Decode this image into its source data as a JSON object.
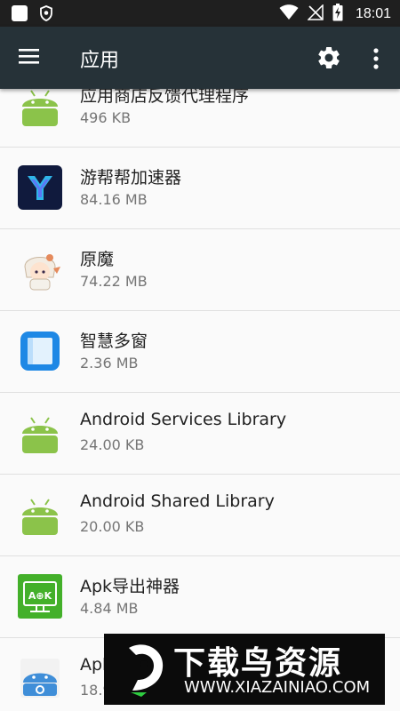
{
  "status_bar": {
    "time": "18:01",
    "icons": [
      "notification-square-icon",
      "shield-icon",
      "wifi-icon",
      "no-sim-icon",
      "battery-charging-icon"
    ]
  },
  "app_bar": {
    "title": "应用",
    "icons": [
      "menu-icon",
      "settings-gear-icon",
      "more-vert-icon"
    ]
  },
  "apps": [
    {
      "name": "应用商店反馈代理程序",
      "size": "496 KB",
      "icon": "android-robot-icon"
    },
    {
      "name": "游帮帮加速器",
      "size": "84.16 MB",
      "icon": "youbangbang-logo-icon"
    },
    {
      "name": "原魔",
      "size": "74.22 MB",
      "icon": "anime-character-icon"
    },
    {
      "name": "智慧多窗",
      "size": "2.36 MB",
      "icon": "multiwindow-icon"
    },
    {
      "name": "Android Services Library",
      "size": "24.00 KB",
      "icon": "android-robot-icon"
    },
    {
      "name": "Android Shared Library",
      "size": "20.00 KB",
      "icon": "android-robot-icon"
    },
    {
      "name": "Apk导出神器",
      "size": "4.84 MB",
      "icon": "apk-export-icon"
    },
    {
      "name": "Apk",
      "size": "18.9",
      "icon": "android-settings-icon"
    }
  ],
  "watermark": {
    "title": "下载鸟资源",
    "url": "WWW.XIAZAINIAO.COM"
  },
  "colors": {
    "app_bar": "#263238",
    "status_bar": "#1f1f1f",
    "android_green": "#8bc34a",
    "background": "#fafafa"
  }
}
